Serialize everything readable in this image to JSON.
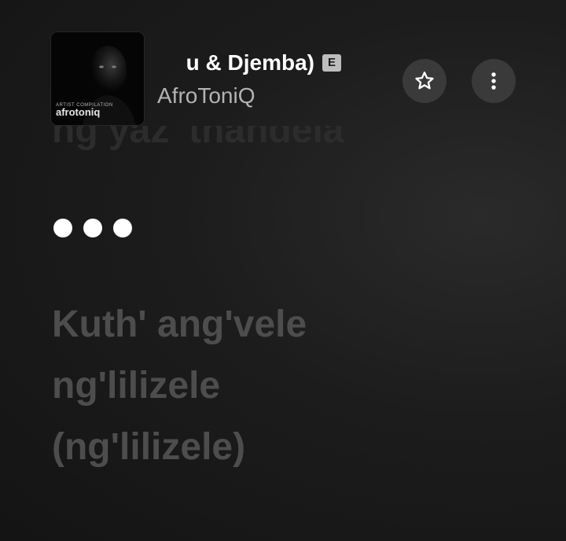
{
  "now_playing": {
    "title": "u & Djemba)",
    "explicit_badge": "E",
    "artist": "AfroToniQ",
    "album_art": {
      "subtitle": "ARTIST COMPILATION",
      "wordmark": "afrotoniq"
    }
  },
  "actions": {
    "favorite_icon": "star-outline-icon",
    "more_icon": "vertical-ellipsis-icon"
  },
  "lyrics": {
    "previous_line": "ng yaz' thandela",
    "instrumental_indicator": "dots",
    "upcoming_lines": [
      "Kuth' ang'vele",
      "ng'lilizele",
      "(ng'lilizele)"
    ]
  },
  "colors": {
    "background": "#1c1c1c",
    "button_bg": "#3a3a3a",
    "upcoming_lyric": "#4d4d4d",
    "past_lyric": "#2c2c2c",
    "artist_text": "#b3b3b3"
  }
}
